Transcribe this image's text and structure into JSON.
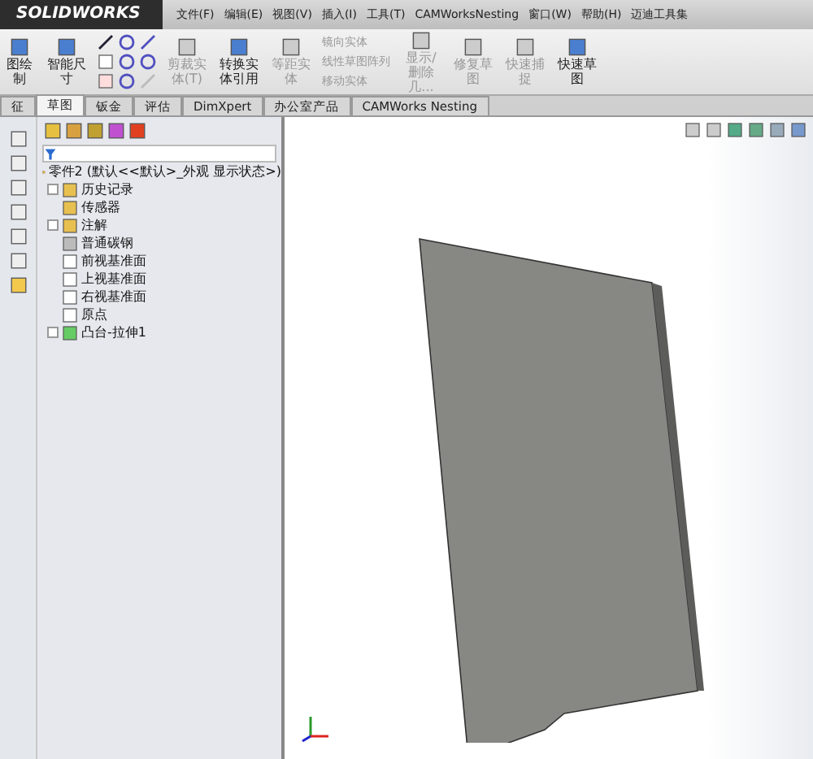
{
  "menu_bar": {
    "logo": "SOLIDWORKS",
    "items": [
      "文件(F)",
      "编辑(E)",
      "视图(V)",
      "插入(I)",
      "工具(T)",
      "CAMWorksNesting",
      "窗口(W)",
      "帮助(H)",
      "迈迪工具集"
    ]
  },
  "ribbon": {
    "buttons": [
      {
        "label": "图绘制",
        "disabled": false
      },
      {
        "label": "智能尺寸",
        "disabled": false
      },
      {
        "label": "剪裁实体(T)",
        "disabled": true
      },
      {
        "label": "转换实体引用",
        "disabled": false
      },
      {
        "label": "等距实体",
        "disabled": true
      }
    ],
    "small_buttons": [
      "镜向实体",
      "线性草图阵列",
      "移动实体"
    ],
    "buttons2": [
      {
        "label": "显示/删除几...",
        "disabled": true
      },
      {
        "label": "修复草图",
        "disabled": true
      },
      {
        "label": "快速捕捉",
        "disabled": true
      },
      {
        "label": "快速草图",
        "disabled": false
      }
    ]
  },
  "tabs": [
    {
      "label": "征",
      "selected": false
    },
    {
      "label": "草图",
      "selected": true
    },
    {
      "label": "钣金",
      "selected": false
    },
    {
      "label": "评估",
      "selected": false
    },
    {
      "label": "DimXpert",
      "selected": false
    },
    {
      "label": "办公室产品",
      "selected": false
    },
    {
      "label": "CAMWorks Nesting",
      "selected": false
    }
  ],
  "feature_tree": {
    "root": "零件2  (默认<<默认>_外观 显示状态>)",
    "items": [
      {
        "label": "历史记录",
        "expandable": true
      },
      {
        "label": "传感器",
        "expandable": false
      },
      {
        "label": "注解",
        "expandable": true
      },
      {
        "label": "普通碳钢",
        "expandable": false
      },
      {
        "label": "前视基准面",
        "expandable": false
      },
      {
        "label": "上视基准面",
        "expandable": false
      },
      {
        "label": "右视基准面",
        "expandable": false
      },
      {
        "label": "原点",
        "expandable": false
      },
      {
        "label": "凸台-拉伸1",
        "expandable": true
      }
    ]
  }
}
